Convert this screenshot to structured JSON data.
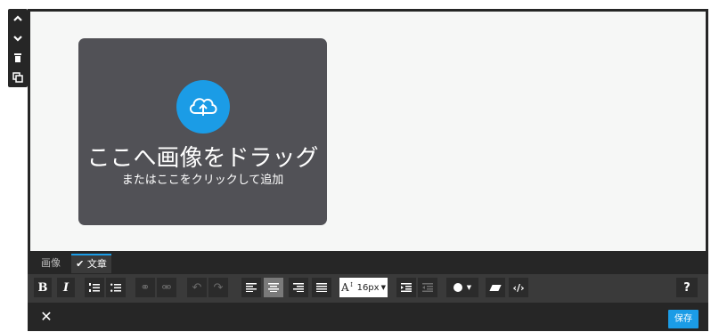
{
  "side_tools": {
    "icons": [
      "chevron-up-icon",
      "chevron-down-icon",
      "trash-icon",
      "duplicate-icon"
    ]
  },
  "dropzone": {
    "title": "ここへ画像をドラッグ",
    "subtitle": "またはここをクリックして追加",
    "icon": "cloud-upload-icon"
  },
  "tabs": {
    "image": "画像",
    "text": "文章"
  },
  "toolbar": {
    "bold": "B",
    "italic": "I",
    "font_size": "16px",
    "help": "?"
  },
  "footer": {
    "close": "✕",
    "save": "保存"
  },
  "colors": {
    "accent": "#1b9ce6",
    "dark": "#262626",
    "toolbar": "#3a3a3a",
    "dropzone": "#515156"
  }
}
